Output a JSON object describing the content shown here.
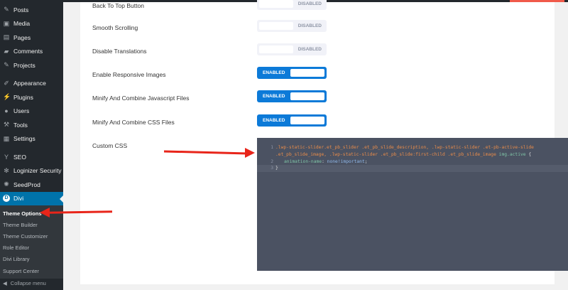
{
  "sidebar": {
    "items": [
      {
        "label": "Posts",
        "icon": "pin-icon"
      },
      {
        "label": "Media",
        "icon": "media-icon"
      },
      {
        "label": "Pages",
        "icon": "pages-icon"
      },
      {
        "label": "Comments",
        "icon": "comment-icon"
      },
      {
        "label": "Projects",
        "icon": "pin-icon"
      },
      {
        "label": "Appearance",
        "icon": "brush-icon"
      },
      {
        "label": "Plugins",
        "icon": "plugin-icon"
      },
      {
        "label": "Users",
        "icon": "user-icon"
      },
      {
        "label": "Tools",
        "icon": "wrench-icon"
      },
      {
        "label": "Settings",
        "icon": "settings-icon"
      },
      {
        "label": "SEO",
        "icon": "yoast-icon"
      },
      {
        "label": "Loginizer Security",
        "icon": "gear-icon"
      },
      {
        "label": "SeedProd",
        "icon": "seed-icon"
      }
    ],
    "divi": "Divi",
    "sub": [
      "Theme Options",
      "Theme Builder",
      "Theme Customizer",
      "Role Editor",
      "Divi Library",
      "Support Center"
    ],
    "collapse": "Collapse menu"
  },
  "settings": [
    {
      "label": "Back To Top Button",
      "state": "DISABLED"
    },
    {
      "label": "Smooth Scrolling",
      "state": "DISABLED"
    },
    {
      "label": "Disable Translations",
      "state": "DISABLED"
    },
    {
      "label": "Enable Responsive Images",
      "state": "ENABLED"
    },
    {
      "label": "Minify And Combine Javascript Files",
      "state": "ENABLED"
    },
    {
      "label": "Minify And Combine CSS Files",
      "state": "ENABLED"
    }
  ],
  "custom_css": {
    "label": "Custom CSS",
    "line1a": ".lwp-static-slider.et_pb_slider .et_pb_slide_description, .lwp-static-slider .et-pb-active-slide",
    "line1b": ".et_pb_slide_image, .lwp-static-slider .et_pb_slide:first-child .et_pb_slide_image ",
    "line1c": "img.active",
    "line1d": " {",
    "prop": "animation-name",
    "colon": ": ",
    "value": "none!important",
    "semi": ";",
    "close": "}",
    "nums": [
      "1",
      "2",
      "3"
    ]
  }
}
